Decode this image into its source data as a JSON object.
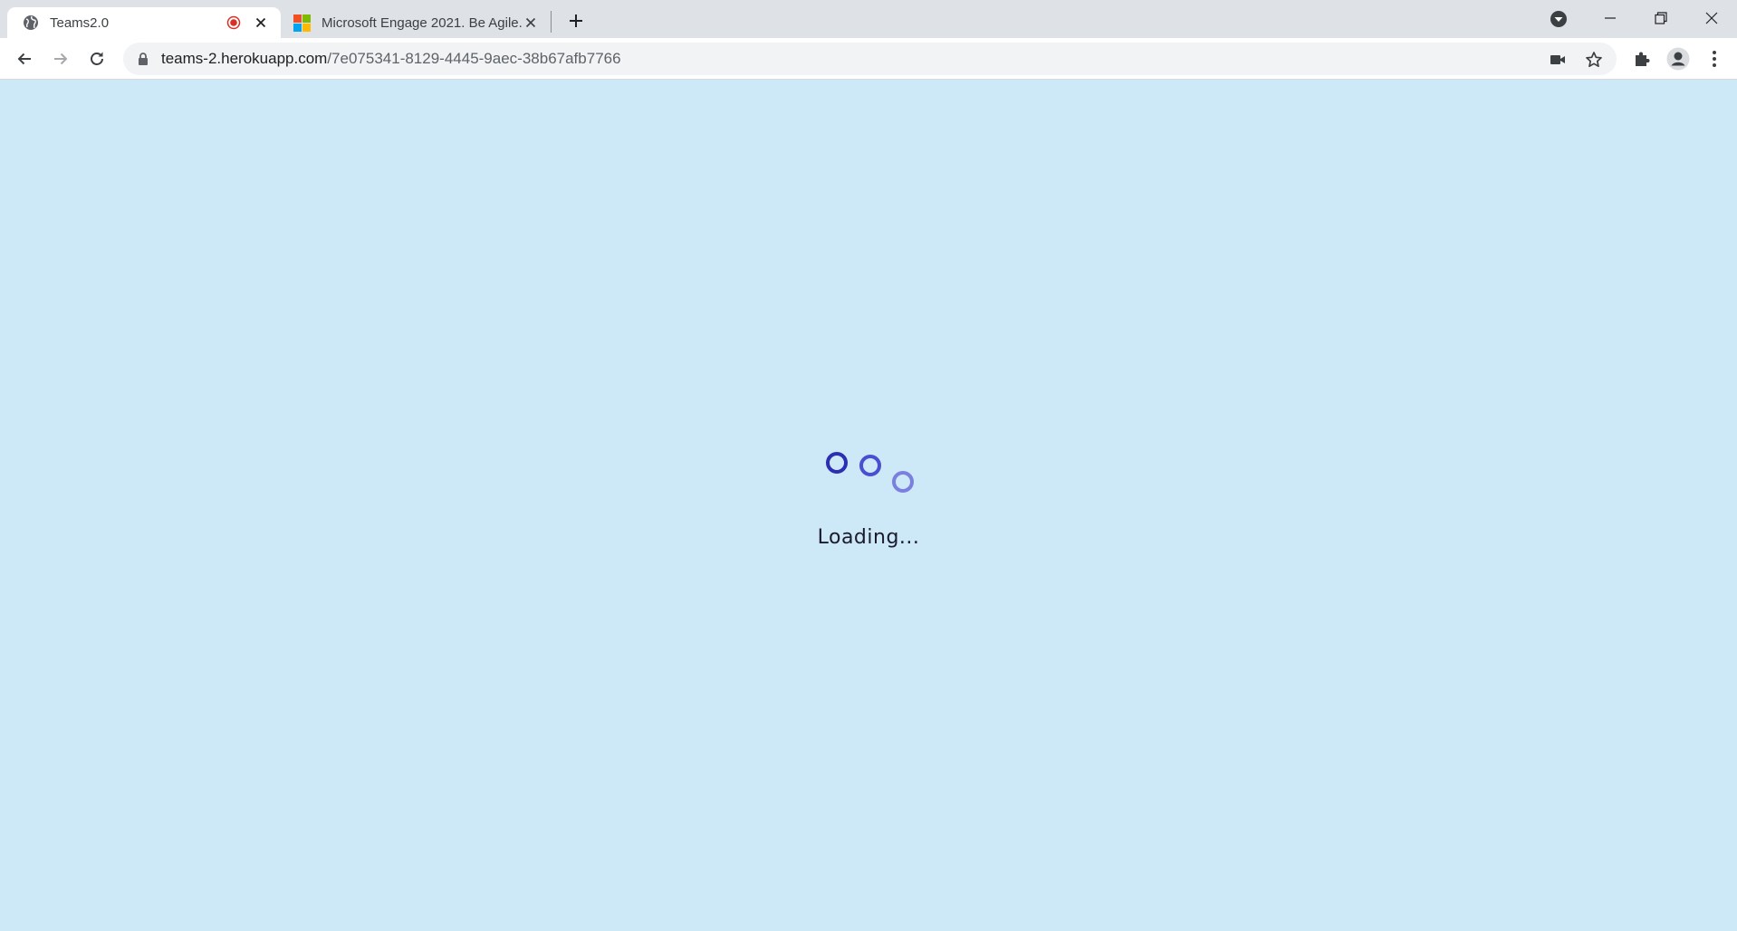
{
  "browser": {
    "tabs": [
      {
        "title": "Teams2.0",
        "favicon": "globe-icon",
        "recording": true,
        "active": true
      },
      {
        "title": "Microsoft Engage 2021. Be Agile.",
        "favicon": "microsoft-logo-icon",
        "active": false
      }
    ],
    "address_bar": {
      "host": "teams-2.herokuapp.com",
      "path": "/7e075341-8129-4445-9aec-38b67afb7766"
    }
  },
  "page": {
    "loading_text": "Loading...",
    "background_color": "#cde8f6",
    "dot_colors": [
      "#2b2fb0",
      "#4a4fd1",
      "#7a7fe0"
    ]
  }
}
